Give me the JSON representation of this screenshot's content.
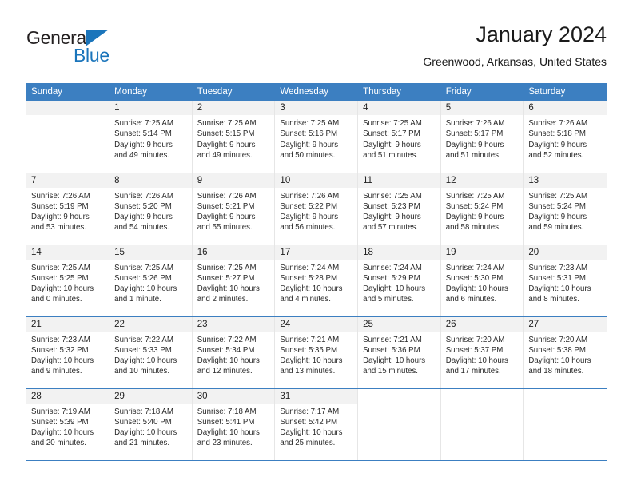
{
  "logo": {
    "text_top": "General",
    "text_bottom": "Blue",
    "triangle_color": "#1b75bb"
  },
  "header": {
    "title": "January 2024",
    "subtitle": "Greenwood, Arkansas, United States"
  },
  "theme": {
    "header_blue": "#3c7fc1",
    "daynum_band": "#f2f2f2",
    "logo_blue": "#1b75bb"
  },
  "weekday_headers": [
    "Sunday",
    "Monday",
    "Tuesday",
    "Wednesday",
    "Thursday",
    "Friday",
    "Saturday"
  ],
  "weeks": [
    [
      {
        "day": "",
        "sunrise": "",
        "sunset": "",
        "daylight_1": "",
        "daylight_2": ""
      },
      {
        "day": "1",
        "sunrise": "Sunrise: 7:25 AM",
        "sunset": "Sunset: 5:14 PM",
        "daylight_1": "Daylight: 9 hours",
        "daylight_2": "and 49 minutes."
      },
      {
        "day": "2",
        "sunrise": "Sunrise: 7:25 AM",
        "sunset": "Sunset: 5:15 PM",
        "daylight_1": "Daylight: 9 hours",
        "daylight_2": "and 49 minutes."
      },
      {
        "day": "3",
        "sunrise": "Sunrise: 7:25 AM",
        "sunset": "Sunset: 5:16 PM",
        "daylight_1": "Daylight: 9 hours",
        "daylight_2": "and 50 minutes."
      },
      {
        "day": "4",
        "sunrise": "Sunrise: 7:25 AM",
        "sunset": "Sunset: 5:17 PM",
        "daylight_1": "Daylight: 9 hours",
        "daylight_2": "and 51 minutes."
      },
      {
        "day": "5",
        "sunrise": "Sunrise: 7:26 AM",
        "sunset": "Sunset: 5:17 PM",
        "daylight_1": "Daylight: 9 hours",
        "daylight_2": "and 51 minutes."
      },
      {
        "day": "6",
        "sunrise": "Sunrise: 7:26 AM",
        "sunset": "Sunset: 5:18 PM",
        "daylight_1": "Daylight: 9 hours",
        "daylight_2": "and 52 minutes."
      }
    ],
    [
      {
        "day": "7",
        "sunrise": "Sunrise: 7:26 AM",
        "sunset": "Sunset: 5:19 PM",
        "daylight_1": "Daylight: 9 hours",
        "daylight_2": "and 53 minutes."
      },
      {
        "day": "8",
        "sunrise": "Sunrise: 7:26 AM",
        "sunset": "Sunset: 5:20 PM",
        "daylight_1": "Daylight: 9 hours",
        "daylight_2": "and 54 minutes."
      },
      {
        "day": "9",
        "sunrise": "Sunrise: 7:26 AM",
        "sunset": "Sunset: 5:21 PM",
        "daylight_1": "Daylight: 9 hours",
        "daylight_2": "and 55 minutes."
      },
      {
        "day": "10",
        "sunrise": "Sunrise: 7:26 AM",
        "sunset": "Sunset: 5:22 PM",
        "daylight_1": "Daylight: 9 hours",
        "daylight_2": "and 56 minutes."
      },
      {
        "day": "11",
        "sunrise": "Sunrise: 7:25 AM",
        "sunset": "Sunset: 5:23 PM",
        "daylight_1": "Daylight: 9 hours",
        "daylight_2": "and 57 minutes."
      },
      {
        "day": "12",
        "sunrise": "Sunrise: 7:25 AM",
        "sunset": "Sunset: 5:24 PM",
        "daylight_1": "Daylight: 9 hours",
        "daylight_2": "and 58 minutes."
      },
      {
        "day": "13",
        "sunrise": "Sunrise: 7:25 AM",
        "sunset": "Sunset: 5:24 PM",
        "daylight_1": "Daylight: 9 hours",
        "daylight_2": "and 59 minutes."
      }
    ],
    [
      {
        "day": "14",
        "sunrise": "Sunrise: 7:25 AM",
        "sunset": "Sunset: 5:25 PM",
        "daylight_1": "Daylight: 10 hours",
        "daylight_2": "and 0 minutes."
      },
      {
        "day": "15",
        "sunrise": "Sunrise: 7:25 AM",
        "sunset": "Sunset: 5:26 PM",
        "daylight_1": "Daylight: 10 hours",
        "daylight_2": "and 1 minute."
      },
      {
        "day": "16",
        "sunrise": "Sunrise: 7:25 AM",
        "sunset": "Sunset: 5:27 PM",
        "daylight_1": "Daylight: 10 hours",
        "daylight_2": "and 2 minutes."
      },
      {
        "day": "17",
        "sunrise": "Sunrise: 7:24 AM",
        "sunset": "Sunset: 5:28 PM",
        "daylight_1": "Daylight: 10 hours",
        "daylight_2": "and 4 minutes."
      },
      {
        "day": "18",
        "sunrise": "Sunrise: 7:24 AM",
        "sunset": "Sunset: 5:29 PM",
        "daylight_1": "Daylight: 10 hours",
        "daylight_2": "and 5 minutes."
      },
      {
        "day": "19",
        "sunrise": "Sunrise: 7:24 AM",
        "sunset": "Sunset: 5:30 PM",
        "daylight_1": "Daylight: 10 hours",
        "daylight_2": "and 6 minutes."
      },
      {
        "day": "20",
        "sunrise": "Sunrise: 7:23 AM",
        "sunset": "Sunset: 5:31 PM",
        "daylight_1": "Daylight: 10 hours",
        "daylight_2": "and 8 minutes."
      }
    ],
    [
      {
        "day": "21",
        "sunrise": "Sunrise: 7:23 AM",
        "sunset": "Sunset: 5:32 PM",
        "daylight_1": "Daylight: 10 hours",
        "daylight_2": "and 9 minutes."
      },
      {
        "day": "22",
        "sunrise": "Sunrise: 7:22 AM",
        "sunset": "Sunset: 5:33 PM",
        "daylight_1": "Daylight: 10 hours",
        "daylight_2": "and 10 minutes."
      },
      {
        "day": "23",
        "sunrise": "Sunrise: 7:22 AM",
        "sunset": "Sunset: 5:34 PM",
        "daylight_1": "Daylight: 10 hours",
        "daylight_2": "and 12 minutes."
      },
      {
        "day": "24",
        "sunrise": "Sunrise: 7:21 AM",
        "sunset": "Sunset: 5:35 PM",
        "daylight_1": "Daylight: 10 hours",
        "daylight_2": "and 13 minutes."
      },
      {
        "day": "25",
        "sunrise": "Sunrise: 7:21 AM",
        "sunset": "Sunset: 5:36 PM",
        "daylight_1": "Daylight: 10 hours",
        "daylight_2": "and 15 minutes."
      },
      {
        "day": "26",
        "sunrise": "Sunrise: 7:20 AM",
        "sunset": "Sunset: 5:37 PM",
        "daylight_1": "Daylight: 10 hours",
        "daylight_2": "and 17 minutes."
      },
      {
        "day": "27",
        "sunrise": "Sunrise: 7:20 AM",
        "sunset": "Sunset: 5:38 PM",
        "daylight_1": "Daylight: 10 hours",
        "daylight_2": "and 18 minutes."
      }
    ],
    [
      {
        "day": "28",
        "sunrise": "Sunrise: 7:19 AM",
        "sunset": "Sunset: 5:39 PM",
        "daylight_1": "Daylight: 10 hours",
        "daylight_2": "and 20 minutes."
      },
      {
        "day": "29",
        "sunrise": "Sunrise: 7:18 AM",
        "sunset": "Sunset: 5:40 PM",
        "daylight_1": "Daylight: 10 hours",
        "daylight_2": "and 21 minutes."
      },
      {
        "day": "30",
        "sunrise": "Sunrise: 7:18 AM",
        "sunset": "Sunset: 5:41 PM",
        "daylight_1": "Daylight: 10 hours",
        "daylight_2": "and 23 minutes."
      },
      {
        "day": "31",
        "sunrise": "Sunrise: 7:17 AM",
        "sunset": "Sunset: 5:42 PM",
        "daylight_1": "Daylight: 10 hours",
        "daylight_2": "and 25 minutes."
      },
      {
        "day": "",
        "sunrise": "",
        "sunset": "",
        "daylight_1": "",
        "daylight_2": ""
      },
      {
        "day": "",
        "sunrise": "",
        "sunset": "",
        "daylight_1": "",
        "daylight_2": ""
      },
      {
        "day": "",
        "sunrise": "",
        "sunset": "",
        "daylight_1": "",
        "daylight_2": ""
      }
    ]
  ]
}
